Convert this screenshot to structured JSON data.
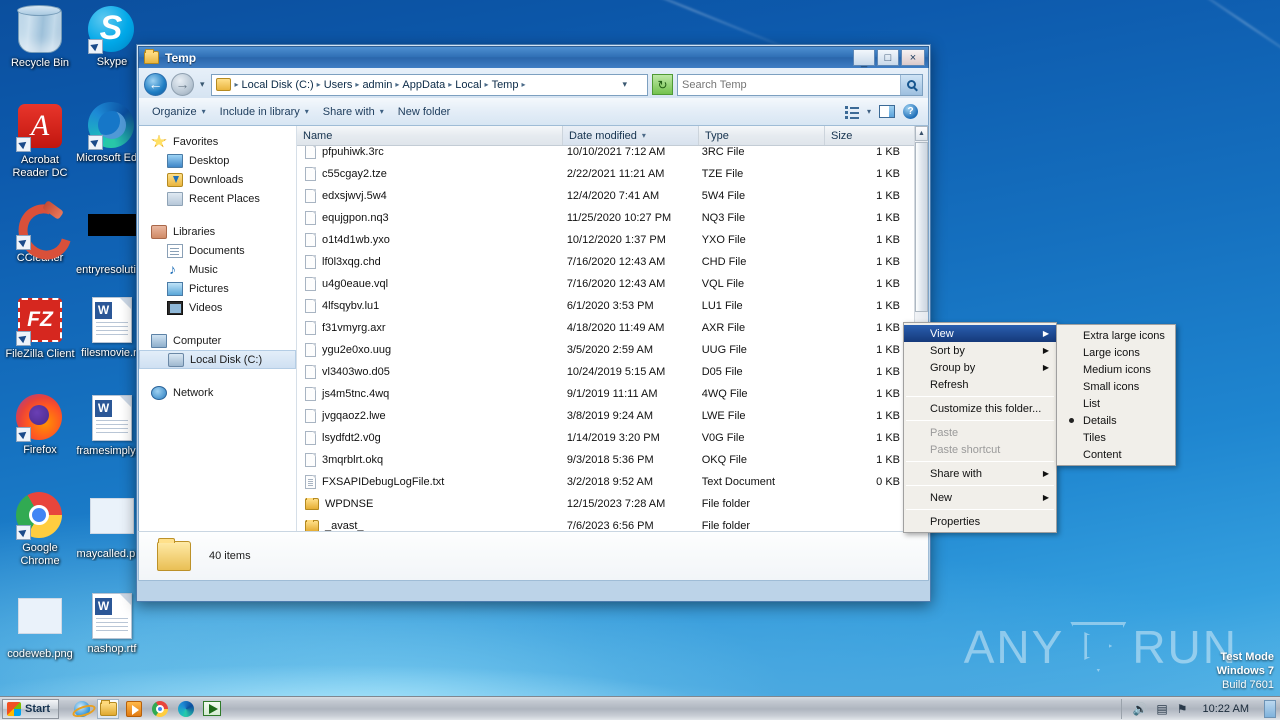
{
  "desktop": {
    "icons": [
      {
        "label": "Recycle Bin",
        "icon": "recycle-bin-icon",
        "shortcut": false
      },
      {
        "label": "Skype",
        "icon": "skype-icon",
        "shortcut": true
      },
      {
        "label": "Acrobat Reader DC",
        "icon": "acrobat-reader-icon",
        "shortcut": true
      },
      {
        "label": "Microsoft Edge",
        "icon": "microsoft-edge-icon",
        "shortcut": true
      },
      {
        "label": "CCleaner",
        "icon": "ccleaner-icon",
        "shortcut": true
      },
      {
        "label": "entryresolution.exe",
        "icon": "black-file-icon",
        "shortcut": false
      },
      {
        "label": "FileZilla Client",
        "icon": "filezilla-icon",
        "shortcut": true
      },
      {
        "label": "filesmovie.rtf",
        "icon": "word-document-icon",
        "shortcut": false
      },
      {
        "label": "Firefox",
        "icon": "firefox-icon",
        "shortcut": true
      },
      {
        "label": "framesimply.rtf",
        "icon": "word-document-icon",
        "shortcut": false
      },
      {
        "label": "Google Chrome",
        "icon": "google-chrome-icon",
        "shortcut": true
      },
      {
        "label": "maycalled.png",
        "icon": "png-image-icon",
        "shortcut": false
      },
      {
        "label": "codeweb.png",
        "icon": "png-image-icon",
        "shortcut": false
      },
      {
        "label": "nashop.rtf",
        "icon": "word-document-icon",
        "shortcut": false
      }
    ]
  },
  "window": {
    "title": "Temp",
    "minimize_label": "_",
    "maximize_label": "□",
    "close_label": "×",
    "back_label": "←",
    "forward_label": "→",
    "history_caret": "▾",
    "breadcrumb": [
      "Local Disk (C:)",
      "Users",
      "admin",
      "AppData",
      "Local",
      "Temp"
    ],
    "breadcrumb_separator": "▸",
    "address_caret": "▾",
    "refresh_label": "↻",
    "search": {
      "placeholder": "Search Temp",
      "value": "",
      "button_icon": "search-icon"
    }
  },
  "toolbar": {
    "items": [
      {
        "label": "Organize",
        "has_caret": true
      },
      {
        "label": "Include in library",
        "has_caret": true
      },
      {
        "label": "Share with",
        "has_caret": true
      },
      {
        "label": "New folder",
        "has_caret": false
      }
    ],
    "caret": "▾",
    "view_icon": "view-options-icon",
    "view_caret": "▾",
    "preview_pane_icon": "preview-pane-icon",
    "help_icon": "help-icon",
    "help_label": "?"
  },
  "navpane": {
    "groups": [
      {
        "label": "Favorites",
        "icon": "star-icon",
        "indent": false,
        "children": [
          {
            "label": "Desktop",
            "icon": "desktop-icon"
          },
          {
            "label": "Downloads",
            "icon": "downloads-icon"
          },
          {
            "label": "Recent Places",
            "icon": "recent-places-icon"
          }
        ]
      },
      {
        "label": "Libraries",
        "icon": "libraries-icon",
        "indent": false,
        "children": [
          {
            "label": "Documents",
            "icon": "documents-icon"
          },
          {
            "label": "Music",
            "icon": "music-icon"
          },
          {
            "label": "Pictures",
            "icon": "pictures-icon"
          },
          {
            "label": "Videos",
            "icon": "videos-icon"
          }
        ]
      },
      {
        "label": "Computer",
        "icon": "computer-icon",
        "indent": false,
        "children": [
          {
            "label": "Local Disk (C:)",
            "icon": "local-disk-icon",
            "selected": true
          }
        ]
      },
      {
        "label": "Network",
        "icon": "network-icon",
        "indent": false,
        "children": []
      }
    ]
  },
  "filelist": {
    "columns": [
      {
        "label": "Name",
        "sorted": false
      },
      {
        "label": "Date modified",
        "sorted": true,
        "sort_arrow": "▾"
      },
      {
        "label": "Type",
        "sorted": false
      },
      {
        "label": "Size",
        "sorted": false
      }
    ],
    "rows": [
      {
        "name": "pfpuhiwk.3rc",
        "date": "10/10/2021 7:12 AM",
        "type": "3RC File",
        "size": "1 KB",
        "icon": "file-icon"
      },
      {
        "name": "c55cgay2.tze",
        "date": "2/22/2021 11:21 AM",
        "type": "TZE File",
        "size": "1 KB",
        "icon": "file-icon"
      },
      {
        "name": "edxsjwvj.5w4",
        "date": "12/4/2020 7:41 AM",
        "type": "5W4 File",
        "size": "1 KB",
        "icon": "file-icon"
      },
      {
        "name": "equjgpon.nq3",
        "date": "11/25/2020 10:27 PM",
        "type": "NQ3 File",
        "size": "1 KB",
        "icon": "file-icon"
      },
      {
        "name": "o1t4d1wb.yxo",
        "date": "10/12/2020 1:37 PM",
        "type": "YXO File",
        "size": "1 KB",
        "icon": "file-icon"
      },
      {
        "name": "lf0l3xqg.chd",
        "date": "7/16/2020 12:43 AM",
        "type": "CHD File",
        "size": "1 KB",
        "icon": "file-icon"
      },
      {
        "name": "u4g0eaue.vql",
        "date": "7/16/2020 12:43 AM",
        "type": "VQL File",
        "size": "1 KB",
        "icon": "file-icon"
      },
      {
        "name": "4lfsqybv.lu1",
        "date": "6/1/2020 3:53 PM",
        "type": "LU1 File",
        "size": "1 KB",
        "icon": "file-icon"
      },
      {
        "name": "f31vmyrg.axr",
        "date": "4/18/2020 11:49 AM",
        "type": "AXR File",
        "size": "1 KB",
        "icon": "file-icon"
      },
      {
        "name": "ygu2e0xo.uug",
        "date": "3/5/2020 2:59 AM",
        "type": "UUG File",
        "size": "1 KB",
        "icon": "file-icon"
      },
      {
        "name": "vl3403wo.d05",
        "date": "10/24/2019 5:15 AM",
        "type": "D05 File",
        "size": "1 KB",
        "icon": "file-icon"
      },
      {
        "name": "js4m5tnc.4wq",
        "date": "9/1/2019 11:11 AM",
        "type": "4WQ File",
        "size": "1 KB",
        "icon": "file-icon"
      },
      {
        "name": "jvgqaoz2.lwe",
        "date": "3/8/2019 9:24 AM",
        "type": "LWE File",
        "size": "1 KB",
        "icon": "file-icon"
      },
      {
        "name": "lsydfdt2.v0g",
        "date": "1/14/2019 3:20 PM",
        "type": "V0G File",
        "size": "1 KB",
        "icon": "file-icon"
      },
      {
        "name": "3mqrblrt.okq",
        "date": "9/3/2018 5:36 PM",
        "type": "OKQ File",
        "size": "1 KB",
        "icon": "file-icon"
      },
      {
        "name": "FXSAPIDebugLogFile.txt",
        "date": "3/2/2018 9:52 AM",
        "type": "Text Document",
        "size": "0 KB",
        "icon": "text-file-icon"
      },
      {
        "name": "WPDNSE",
        "date": "12/15/2023 7:28 AM",
        "type": "File folder",
        "size": "",
        "icon": "folder-icon"
      },
      {
        "name": "_avast_",
        "date": "7/6/2023 6:56 PM",
        "type": "File folder",
        "size": "",
        "icon": "folder-icon"
      }
    ],
    "scroll_up_label": "▲",
    "scroll_down_label": "▼"
  },
  "statusbar": {
    "item_count": "40 items",
    "icon": "folder-icon"
  },
  "context_menu": {
    "items": [
      {
        "label": "View",
        "submenu": true,
        "highlighted": true,
        "disabled": false
      },
      {
        "label": "Sort by",
        "submenu": true,
        "highlighted": false,
        "disabled": false
      },
      {
        "label": "Group by",
        "submenu": true,
        "highlighted": false,
        "disabled": false
      },
      {
        "label": "Refresh",
        "submenu": false,
        "highlighted": false,
        "disabled": false
      },
      {
        "separator": true
      },
      {
        "label": "Customize this folder...",
        "submenu": false,
        "highlighted": false,
        "disabled": false
      },
      {
        "separator": true
      },
      {
        "label": "Paste",
        "submenu": false,
        "highlighted": false,
        "disabled": true
      },
      {
        "label": "Paste shortcut",
        "submenu": false,
        "highlighted": false,
        "disabled": true
      },
      {
        "separator": true
      },
      {
        "label": "Share with",
        "submenu": true,
        "highlighted": false,
        "disabled": false
      },
      {
        "separator": true
      },
      {
        "label": "New",
        "submenu": true,
        "highlighted": false,
        "disabled": false
      },
      {
        "separator": true
      },
      {
        "label": "Properties",
        "submenu": false,
        "highlighted": false,
        "disabled": false
      }
    ],
    "submenu_arrow": "▶"
  },
  "view_submenu": {
    "items": [
      {
        "label": "Extra large icons",
        "checked": false
      },
      {
        "label": "Large icons",
        "checked": false
      },
      {
        "label": "Medium icons",
        "checked": false
      },
      {
        "label": "Small icons",
        "checked": false
      },
      {
        "label": "List",
        "checked": false
      },
      {
        "label": "Details",
        "checked": true
      },
      {
        "label": "Tiles",
        "checked": false
      },
      {
        "label": "Content",
        "checked": false
      }
    ]
  },
  "watermark": {
    "any": "ANY",
    "run": "RUN",
    "play_icon": "play-triangle-icon"
  },
  "test_mode": {
    "line1": "Test Mode",
    "line2": "Windows 7",
    "line3": "Build 7601"
  },
  "taskbar": {
    "start_label": "Start",
    "quick_launch": [
      {
        "name": "internet-explorer-icon"
      },
      {
        "name": "windows-explorer-icon",
        "active": true
      },
      {
        "name": "windows-media-player-icon"
      },
      {
        "name": "google-chrome-icon"
      },
      {
        "name": "microsoft-edge-icon"
      },
      {
        "name": "media-play-icon"
      }
    ],
    "tray": [
      {
        "name": "volume-icon",
        "glyph": "🔊"
      },
      {
        "name": "network-icon",
        "glyph": "▤"
      },
      {
        "name": "action-center-icon",
        "glyph": "⚑"
      }
    ],
    "clock": "10:22 AM",
    "show_desktop": "show-desktop-button"
  }
}
